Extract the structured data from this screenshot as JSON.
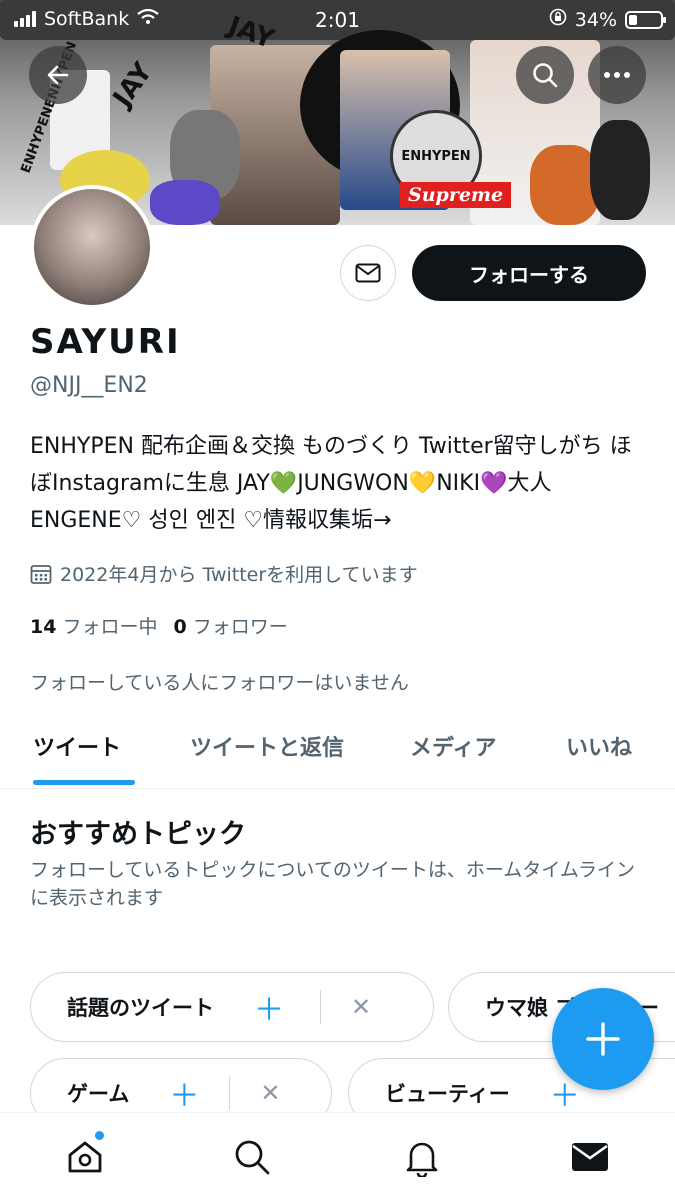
{
  "status_bar": {
    "carrier": "SoftBank",
    "time": "2:01",
    "battery": "34%",
    "battery_level": 0.34
  },
  "banner": {
    "text_jay_1": "JAY",
    "text_jay_2": "JAY",
    "text_enhypen": "ENHYPENENHYPEN",
    "badge_text": "ENHYPEN",
    "supreme": "Supreme"
  },
  "profile": {
    "name": "SAYURI",
    "handle": "@NJJ__EN2",
    "bio": "ENHYPEN 配布企画＆交換 ものづくり Twitter留守しがち ほぼInstagramに生息 JAY💚JUNGWON💛NIKI💜大人ENGENE♡ 성인 엔진 ♡情報収集垢→",
    "joined": "2022年4月から Twitterを利用しています",
    "following_count": "14",
    "following_label": "フォロー中",
    "followers_count": "0",
    "followers_label": "フォロワー",
    "no_followers_note": "フォローしている人にフォロワーはいません"
  },
  "buttons": {
    "follow": "フォローする"
  },
  "tabs": [
    {
      "label": "ツイート"
    },
    {
      "label": "ツイートと返信"
    },
    {
      "label": "メディア"
    },
    {
      "label": "いいね"
    }
  ],
  "topics": {
    "title": "おすすめトピック",
    "subtitle": "フォローしているトピックについてのツイートは、ホームタイムラインに表示されます",
    "chips": [
      {
        "label": "話題のツイート"
      },
      {
        "label": "ウマ娘 プリティー"
      },
      {
        "label": "ゲーム"
      },
      {
        "label": "ビューティー"
      }
    ]
  },
  "icons": {
    "back": "arrow-left-icon",
    "search": "search-icon",
    "more": "more-icon",
    "message": "envelope-icon",
    "calendar": "calendar-icon",
    "compose": "plus-icon",
    "home": "home-icon",
    "explore": "search-icon",
    "notifications": "bell-icon",
    "messages": "envelope-icon"
  },
  "colors": {
    "accent": "#1d9bf0",
    "text": "#0f1419",
    "secondary": "#536471"
  }
}
